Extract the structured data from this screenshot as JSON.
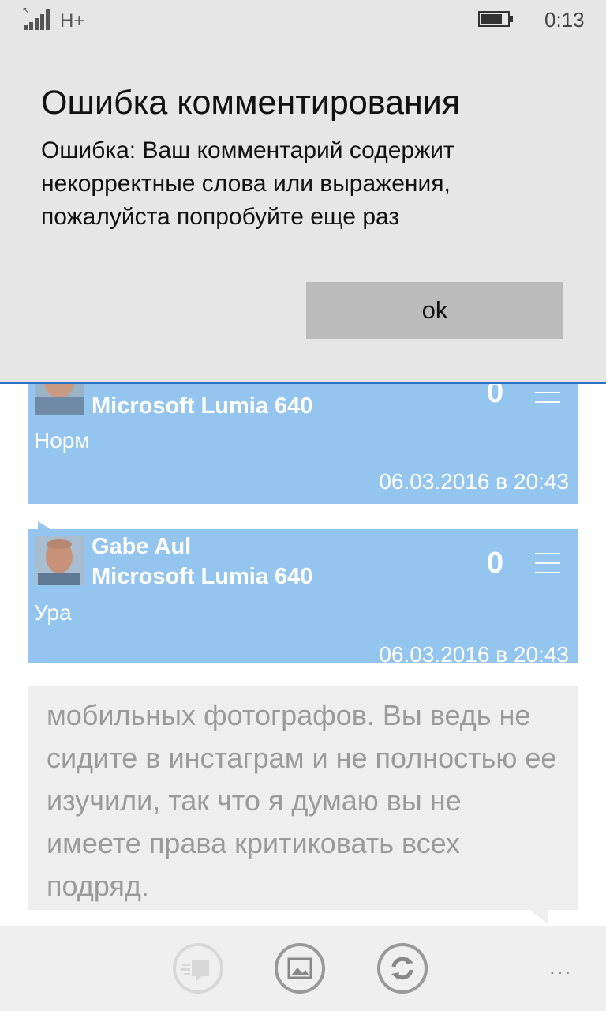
{
  "status_bar": {
    "network": "H+",
    "time": "0:13",
    "battery_level": 0.8
  },
  "dialog": {
    "title": "Ошибка комментирования",
    "message": "Ошибка: Ваш комментарий содержит некорректные слова или выражения, пожалуйста попробуйте еще раз",
    "ok_label": "ok"
  },
  "comments": [
    {
      "device": "Microsoft Lumia 640",
      "text": "Норм",
      "date": "06.03.2016 в 20:43",
      "score": "0"
    },
    {
      "author": "Gabe Aul",
      "device": "Microsoft Lumia 640",
      "text": "Ура",
      "date": "06.03.2016 в 20:43",
      "score": "0"
    }
  ],
  "quote": {
    "text": "мобильных фотографов. Вы ведь не сидите в инстаграм и не полностью ее изучили, так что я думаю вы не имеете права критиковать всех подряд."
  },
  "app_bar": {
    "more": "..."
  },
  "colors": {
    "comment_bg": "#94c5ee",
    "dialog_bg": "#e6e6e6",
    "accent_line": "#2a73c4"
  }
}
